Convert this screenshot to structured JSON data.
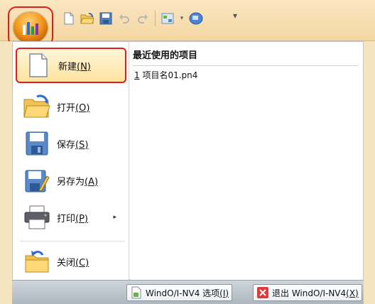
{
  "quick_access": {
    "icons": [
      "new-file-icon",
      "open-folder-icon",
      "save-icon",
      "undo-icon",
      "redo-icon",
      "view-icon",
      "monitor-icon"
    ],
    "overflow": "▾"
  },
  "menu": {
    "items": [
      {
        "label": "新建",
        "key": "(N)",
        "icon": "new-document-icon"
      },
      {
        "label": "打开",
        "key": "(O)",
        "icon": "open-folder-icon"
      },
      {
        "label": "保存",
        "key": "(S)",
        "icon": "save-disk-icon"
      },
      {
        "label": "另存为",
        "key": "(A)",
        "icon": "save-as-icon"
      },
      {
        "label": "打印",
        "key": "(P)",
        "icon": "printer-icon"
      },
      {
        "label": "关闭",
        "key": "(C)",
        "icon": "close-folder-icon"
      }
    ],
    "print_arrow": "▸"
  },
  "recent": {
    "title": "最近使用的项目",
    "items": [
      {
        "index": "1",
        "name": "项目名01.pn4"
      }
    ]
  },
  "bottom": {
    "options_label": "WindO/I-NV4 选项",
    "options_key": "(I)",
    "exit_label": "退出 WindO/I-NV4",
    "exit_key": "(X)"
  },
  "colors": {
    "highlight": "#e21c1c",
    "accent": "#f39a1a"
  }
}
